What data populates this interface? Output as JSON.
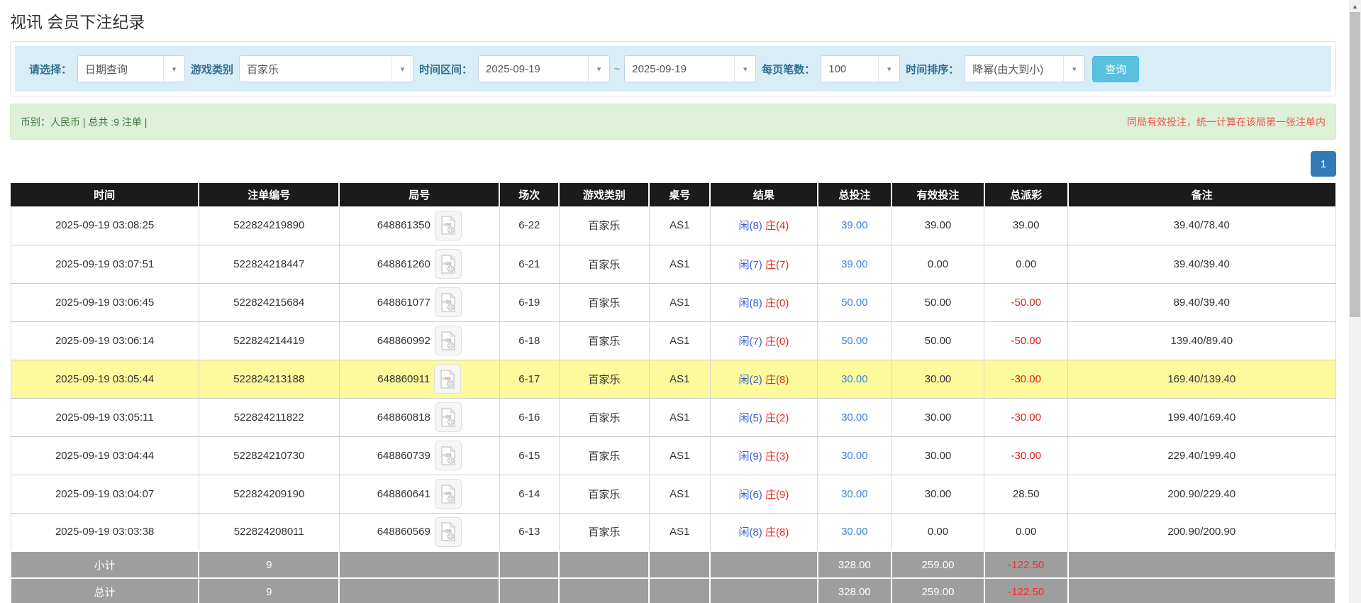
{
  "page": {
    "title": "视讯 会员下注纪录"
  },
  "icons": {
    "chevron_down": "▾",
    "scroll_up": "▲"
  },
  "filters": {
    "mode_label": "请选择：",
    "mode_value": "日期查询",
    "game_label": "游戏类别",
    "game_value": "百家乐",
    "range_label": "时间区间：",
    "date_from": "2025-09-19",
    "range_separator": "~",
    "date_to": "2025-09-19",
    "per_page_label": "每页笔数：",
    "per_page_value": "100",
    "sort_label": "时间排序：",
    "sort_value": "降幂(由大到小)",
    "search_button": "查询"
  },
  "summary": {
    "left_text": "币别：人民币 | 总共 :9 注单 |",
    "right_text": "同局有效投注，统一计算在该局第一张注单内"
  },
  "pagination": {
    "current_page": "1"
  },
  "table": {
    "headers": [
      "时间",
      "注单编号",
      "局号",
      "场次",
      "游戏类别",
      "桌号",
      "结果",
      "总投注",
      "有效投注",
      "总派彩",
      "备注"
    ],
    "header_keys": [
      "time",
      "bet-id",
      "round-id",
      "session",
      "game-type",
      "table-no",
      "result",
      "total-bet",
      "valid-bet",
      "payout",
      "note"
    ],
    "col_widths": [
      "14.2%",
      "10.6%",
      "12.1%",
      "4.5%",
      "6.8%",
      "4.6%",
      "8.1%",
      "5.6%",
      "7.0%",
      "6.3%",
      "20.2%"
    ],
    "rows": [
      {
        "time": "2025-09-19 03:08:25",
        "bet_id": "522824219890",
        "round_id": "648861350",
        "session": "6-22",
        "game": "百家乐",
        "table_id": "AS1",
        "player": "闲(8)",
        "banker": "庄(4)",
        "total_bet": "39.00",
        "valid_bet": "39.00",
        "payout": "39.00",
        "note": "39.40/78.40",
        "highlight": false
      },
      {
        "time": "2025-09-19 03:07:51",
        "bet_id": "522824218447",
        "round_id": "648861260",
        "session": "6-21",
        "game": "百家乐",
        "table_id": "AS1",
        "player": "闲(7)",
        "banker": "庄(7)",
        "total_bet": "39.00",
        "valid_bet": "0.00",
        "payout": "0.00",
        "note": "39.40/39.40",
        "highlight": false
      },
      {
        "time": "2025-09-19 03:06:45",
        "bet_id": "522824215684",
        "round_id": "648861077",
        "session": "6-19",
        "game": "百家乐",
        "table_id": "AS1",
        "player": "闲(8)",
        "banker": "庄(0)",
        "total_bet": "50.00",
        "valid_bet": "50.00",
        "payout": "-50.00",
        "note": "89.40/39.40",
        "highlight": false
      },
      {
        "time": "2025-09-19 03:06:14",
        "bet_id": "522824214419",
        "round_id": "648860992",
        "session": "6-18",
        "game": "百家乐",
        "table_id": "AS1",
        "player": "闲(7)",
        "banker": "庄(0)",
        "total_bet": "50.00",
        "valid_bet": "50.00",
        "payout": "-50.00",
        "note": "139.40/89.40",
        "highlight": false
      },
      {
        "time": "2025-09-19 03:05:44",
        "bet_id": "522824213188",
        "round_id": "648860911",
        "session": "6-17",
        "game": "百家乐",
        "table_id": "AS1",
        "player": "闲(2)",
        "banker": "庄(8)",
        "total_bet": "30.00",
        "valid_bet": "30.00",
        "payout": "-30.00",
        "note": "169.40/139.40",
        "highlight": true
      },
      {
        "time": "2025-09-19 03:05:11",
        "bet_id": "522824211822",
        "round_id": "648860818",
        "session": "6-16",
        "game": "百家乐",
        "table_id": "AS1",
        "player": "闲(5)",
        "banker": "庄(2)",
        "total_bet": "30.00",
        "valid_bet": "30.00",
        "payout": "-30.00",
        "note": "199.40/169.40",
        "highlight": false
      },
      {
        "time": "2025-09-19 03:04:44",
        "bet_id": "522824210730",
        "round_id": "648860739",
        "session": "6-15",
        "game": "百家乐",
        "table_id": "AS1",
        "player": "闲(9)",
        "banker": "庄(3)",
        "total_bet": "30.00",
        "valid_bet": "30.00",
        "payout": "-30.00",
        "note": "229.40/199.40",
        "highlight": false
      },
      {
        "time": "2025-09-19 03:04:07",
        "bet_id": "522824209190",
        "round_id": "648860641",
        "session": "6-14",
        "game": "百家乐",
        "table_id": "AS1",
        "player": "闲(6)",
        "banker": "庄(9)",
        "total_bet": "30.00",
        "valid_bet": "30.00",
        "payout": "28.50",
        "note": "200.90/229.40",
        "highlight": false
      },
      {
        "time": "2025-09-19 03:03:38",
        "bet_id": "522824208011",
        "round_id": "648860569",
        "session": "6-13",
        "game": "百家乐",
        "table_id": "AS1",
        "player": "闲(8)",
        "banker": "庄(8)",
        "total_bet": "30.00",
        "valid_bet": "0.00",
        "payout": "0.00",
        "note": "200.90/200.90",
        "highlight": false
      }
    ],
    "footer_rows": [
      {
        "label": "小计",
        "count": "9",
        "total_bet": "328.00",
        "valid_bet": "259.00",
        "payout": "-122.50"
      },
      {
        "label": "总计",
        "count": "9",
        "total_bet": "328.00",
        "valid_bet": "259.00",
        "payout": "-122.50"
      }
    ]
  },
  "colors": {
    "filter_bar_bg": "#d9edf7",
    "search_button_bg": "#5bc0de",
    "info_bar_bg": "#dff0d8",
    "info_text_green": "#3c763d",
    "notice_red": "#f0544c",
    "pagination_blue": "#337ab7",
    "header_bg": "#1b1b1b",
    "footer_bg": "#9e9e9e",
    "highlight_yellow": "#fbfb9e",
    "total_bet_blue": "#3c86d8",
    "player_blue": "#3b5ed7",
    "banker_red": "#dd2d26",
    "negative_red": "#e61a1a"
  }
}
